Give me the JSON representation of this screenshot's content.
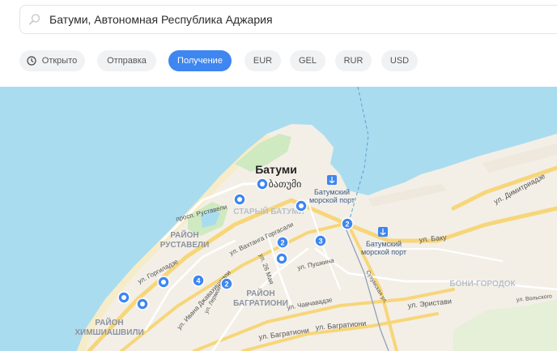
{
  "search": {
    "value": "Батуми, Автономная Республика Аджария",
    "icon": "search-icon"
  },
  "filters": [
    {
      "label": "Открыто",
      "icon": "clock-icon",
      "active": false
    },
    {
      "label": "Отправка",
      "active": false
    },
    {
      "label": "Получение",
      "active": true
    },
    {
      "label": "EUR",
      "active": false
    },
    {
      "label": "GEL",
      "active": false
    },
    {
      "label": "RUR",
      "active": false
    },
    {
      "label": "USD",
      "active": false
    }
  ],
  "colors": {
    "accent": "#3e86f0",
    "water": "#aadcef",
    "land": "#f3efe7",
    "park": "#cfe9c0",
    "road": "#f7d67a"
  },
  "map": {
    "city": "Батуми",
    "city_local": "ბათუმი",
    "districts": [
      "СТАРЫЙ БАТУМИ",
      "РАЙОН",
      "РУСТАВЕЛИ",
      "РАЙОН",
      "БАГРАТИОНИ",
      "РАЙОН",
      "ХИМШИАШВИЛИ",
      "БОНИ-ГОРОДОК"
    ],
    "ports": [
      "Батумский",
      "морской порт",
      "Батумский",
      "морской порт"
    ],
    "streets": [
      "просп. Руставели",
      "ул. Вахтанга Горгасали",
      "ул. Горгиладзе",
      "ул. 26 Мая",
      "ул. Пушкина",
      "ул. Ивана Джавахишвили",
      "ул. Чавчавадзе",
      "ул. Эристави",
      "ул. Багратиони",
      "ул. Багратиони",
      "ул. Баку",
      "ул. Димитриадзе",
      "ул. Вольского",
      "Сухумская ул.",
      "ул. Лермонтова"
    ],
    "markers": [
      "",
      "",
      "2",
      "3",
      "",
      "2",
      "4",
      "2",
      "",
      "",
      "",
      "2"
    ]
  }
}
